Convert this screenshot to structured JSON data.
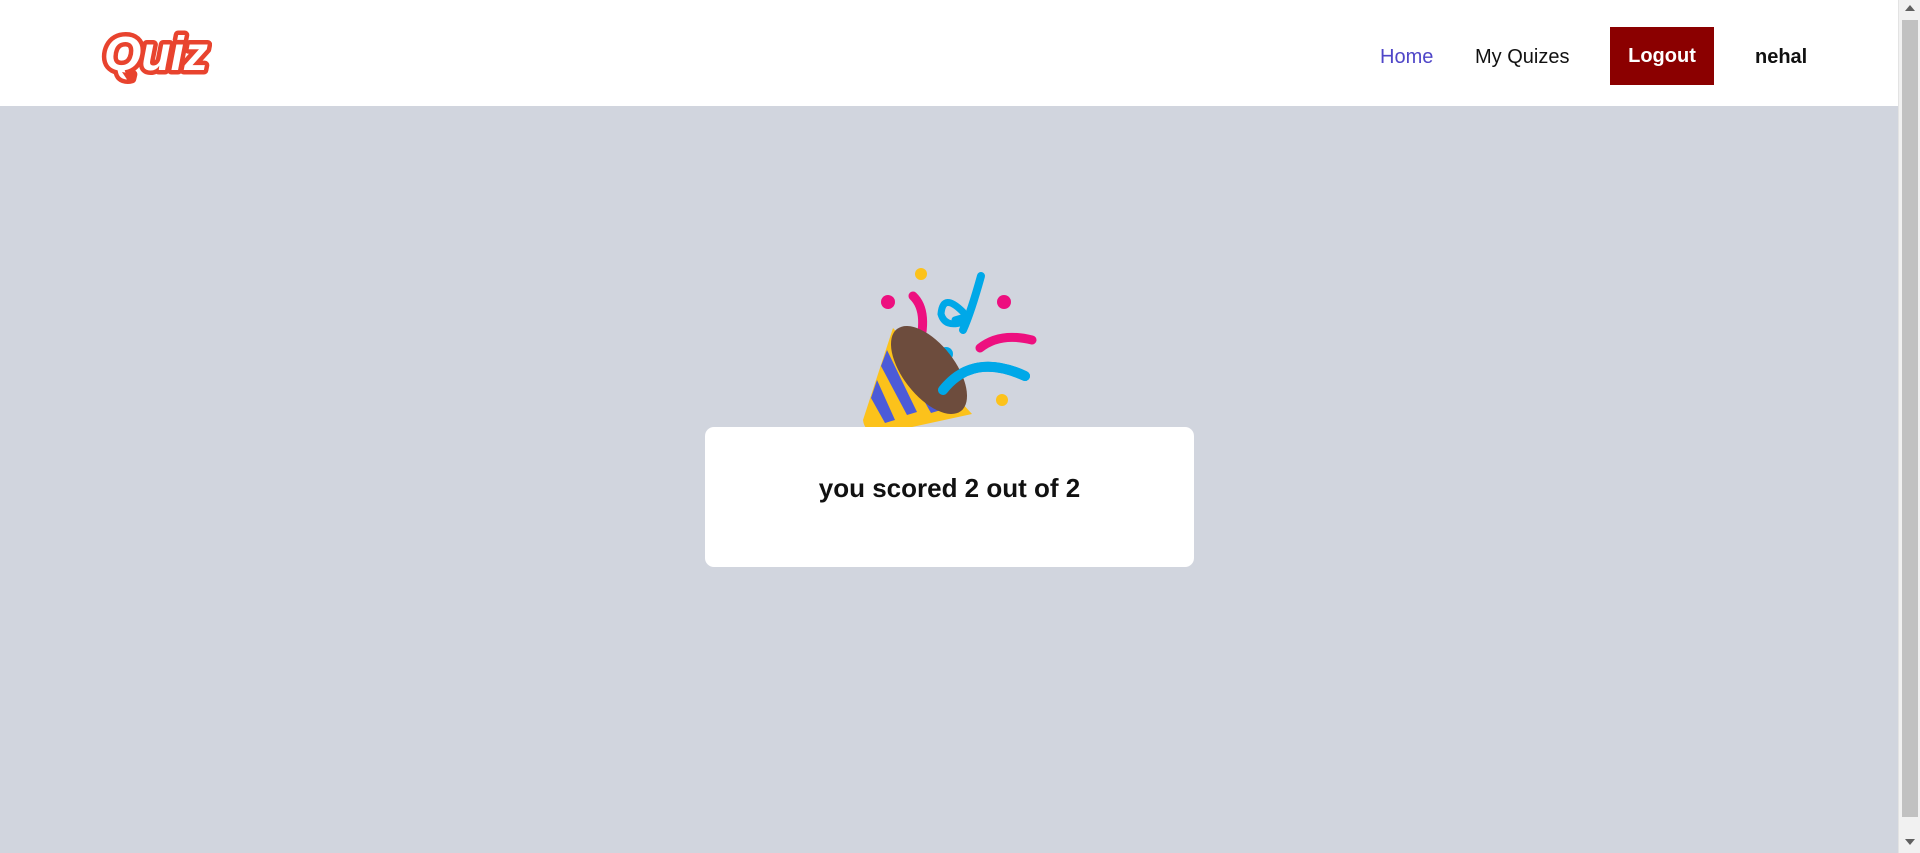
{
  "nav": {
    "logo_text": "Quiz",
    "home_label": "Home",
    "my_quizes_label": "My Quizes",
    "logout_label": "Logout",
    "username": "nehal"
  },
  "result": {
    "icon": "party-popper-icon",
    "text": "you scored 2 out of 2"
  },
  "colors": {
    "logo_red": "#e8432e",
    "active_link": "#4f46c8",
    "logout_bg": "#8b0000",
    "page_bg": "#d1d5de"
  }
}
